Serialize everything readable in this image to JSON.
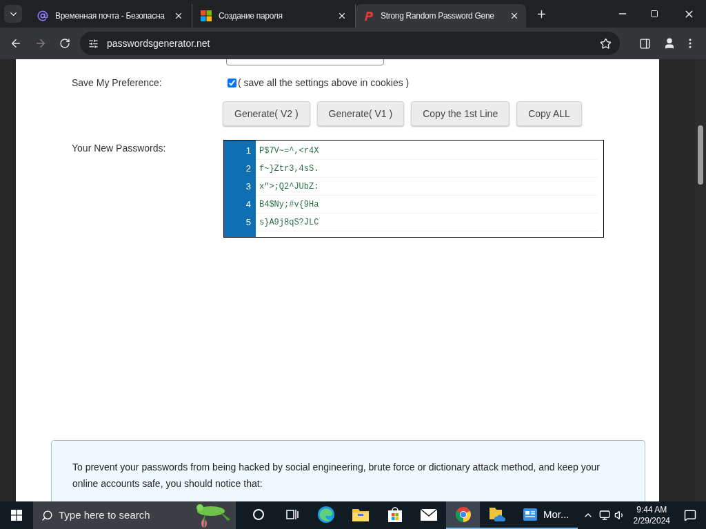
{
  "browser": {
    "tabs": [
      {
        "title": "Временная почта - Безопасна",
        "selected": false,
        "kind": "mail"
      },
      {
        "title": "Создание пароля",
        "selected": false,
        "kind": "windows"
      },
      {
        "title": "Strong Random Password Gene",
        "selected": true,
        "kind": "p"
      }
    ],
    "url": "passwordsgenerator.net"
  },
  "form": {
    "preference": {
      "label": "Save My Preference:",
      "checked": true,
      "text": "( save all the settings above in cookies )"
    },
    "buttons": [
      "Generate( V2 )",
      "Generate( V1 )",
      "Copy the 1st Line",
      "Copy ALL"
    ],
    "passwords_label": "Your New Passwords:",
    "passwords": [
      {
        "number": "1",
        "value": "P$7V~=^,<r4X"
      },
      {
        "number": "2",
        "value": "f~}Ztr3,4sS."
      },
      {
        "number": "3",
        "value": "x\">;Q2^JUbZ:"
      },
      {
        "number": "4",
        "value": "B4$Ny;#v{9Ha"
      },
      {
        "number": "5",
        "value": "s}A9j8qS?JLC"
      }
    ]
  },
  "notice": {
    "paragraph": "To prevent your passwords from being hacked by social engineering, brute force or dictionary attack method, and keep your online accounts safe, you should notice that:"
  },
  "taskbar": {
    "search_placeholder": "Type here to search",
    "apps": [
      {
        "kind": "cortana",
        "active": false
      },
      {
        "kind": "taskview",
        "active": false
      },
      {
        "kind": "edge",
        "active": false
      },
      {
        "kind": "folder",
        "active": false
      },
      {
        "kind": "store",
        "active": false
      },
      {
        "kind": "mail",
        "active": false
      },
      {
        "kind": "chrome",
        "active": true
      },
      {
        "kind": "files",
        "active": true
      },
      {
        "kind": "news",
        "active": true,
        "label": "Mor..."
      }
    ],
    "time": "9:44 AM",
    "date": "2/29/2024"
  }
}
